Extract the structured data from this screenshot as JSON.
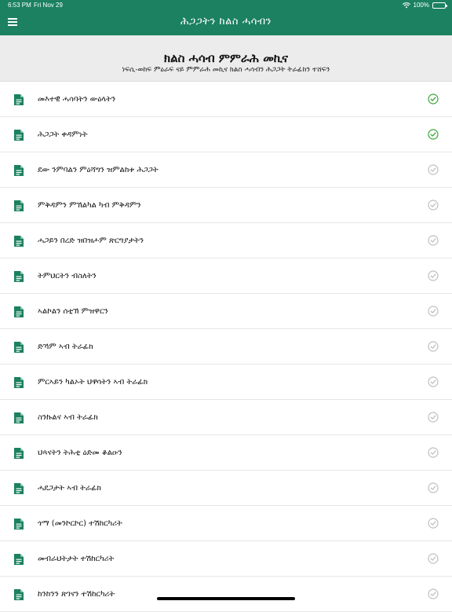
{
  "status_bar": {
    "time": "6:53 PM",
    "date": "Fri Nov 29",
    "battery": "100%"
  },
  "nav": {
    "title": "ሕጋጋትን ከልስ ሓሳብን"
  },
  "header": {
    "title": "ክልስ ሓሳብ ምምራሕ መኪና",
    "subtitle": "ነፍሲ-ወከፍ ምዕራፍ ናይ ምምራሕ መኪና ክልስ ሓሳብን ሕጋጋት ትራፊክን ተሸፍን"
  },
  "colors": {
    "primary": "#1b8160",
    "done": "#3aa537",
    "pending": "#bfbfbf"
  },
  "items": [
    {
      "label": "መእተዊ ሓሳባትን ውዕላትን",
      "completed": true
    },
    {
      "label": "ሕጋጋት ቀዳምነት",
      "completed": true
    },
    {
      "label": "ደው ንምባልን ምዕሻግን ዝምልከቱ ሕጋጋት",
      "completed": false
    },
    {
      "label": "ምቅዳምን ምኽልካል ካብ ምቅዳምን",
      "completed": false
    },
    {
      "label": "ሓጋይን በረድ ዝበዝሖም ጽርግያታትን",
      "completed": false
    },
    {
      "label": "ትምህርትን ብስለትን",
      "completed": false
    },
    {
      "label": "ኣልኮልን ሰቲኽ ምዝዋርን",
      "completed": false
    },
    {
      "label": "ድኻም ኣብ ትራፊክ",
      "completed": false
    },
    {
      "label": "ምርኣይን ካልኦት ህዋሳትን ኣብ ትራፊክ",
      "completed": false
    },
    {
      "label": "ስንኩልና ኣብ ትራፊክ",
      "completed": false
    },
    {
      "label": "ህጻናትን ትሕቲ ዕድመ ቆልዑን",
      "completed": false
    },
    {
      "label": "ሓደጋታት ኣብ ትራፊክ",
      "completed": false
    },
    {
      "label": "ጎማ (መንኮርኮር) ተሽከርካሪት",
      "completed": false
    },
    {
      "label": "መብራህትታት ተሽከርካሪት",
      "completed": false
    },
    {
      "label": "ከንከንን ጽገናን ተሽከርካሪት",
      "completed": false
    }
  ]
}
